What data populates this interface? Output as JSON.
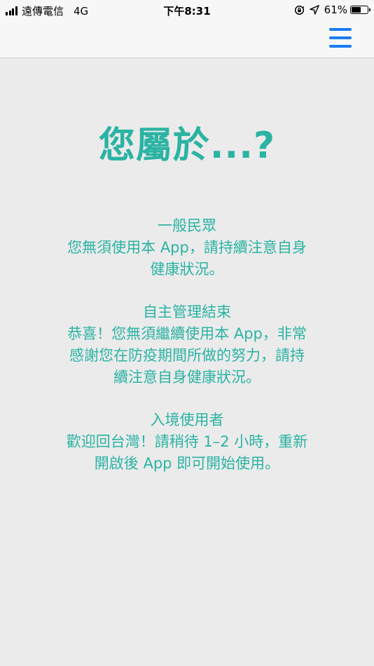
{
  "status_bar": {
    "carrier": "遠傳電信",
    "network": "4G",
    "time": "下午8:31",
    "battery_percent": "61%",
    "battery_level": 0.61,
    "signal_bars": 4
  },
  "nav": {
    "menu_icon": "hamburger-menu-icon",
    "accent_color": "#1a7cf2"
  },
  "main": {
    "title": "您屬於...?",
    "text_color": "#2bb3a3",
    "sections": [
      {
        "title": "一般民眾",
        "description": "您無須使用本 App，請持續注意自身\n健康狀況。"
      },
      {
        "title": "自主管理結束",
        "description": "恭喜！您無須繼續使用本 App，非常\n感謝您在防疫期間所做的努力，請持\n續注意自身健康狀況。"
      },
      {
        "title": "入境使用者",
        "description": "歡迎回台灣！請稍待 1–2 小時，重新\n開啟後 App 即可開始使用。"
      }
    ]
  }
}
